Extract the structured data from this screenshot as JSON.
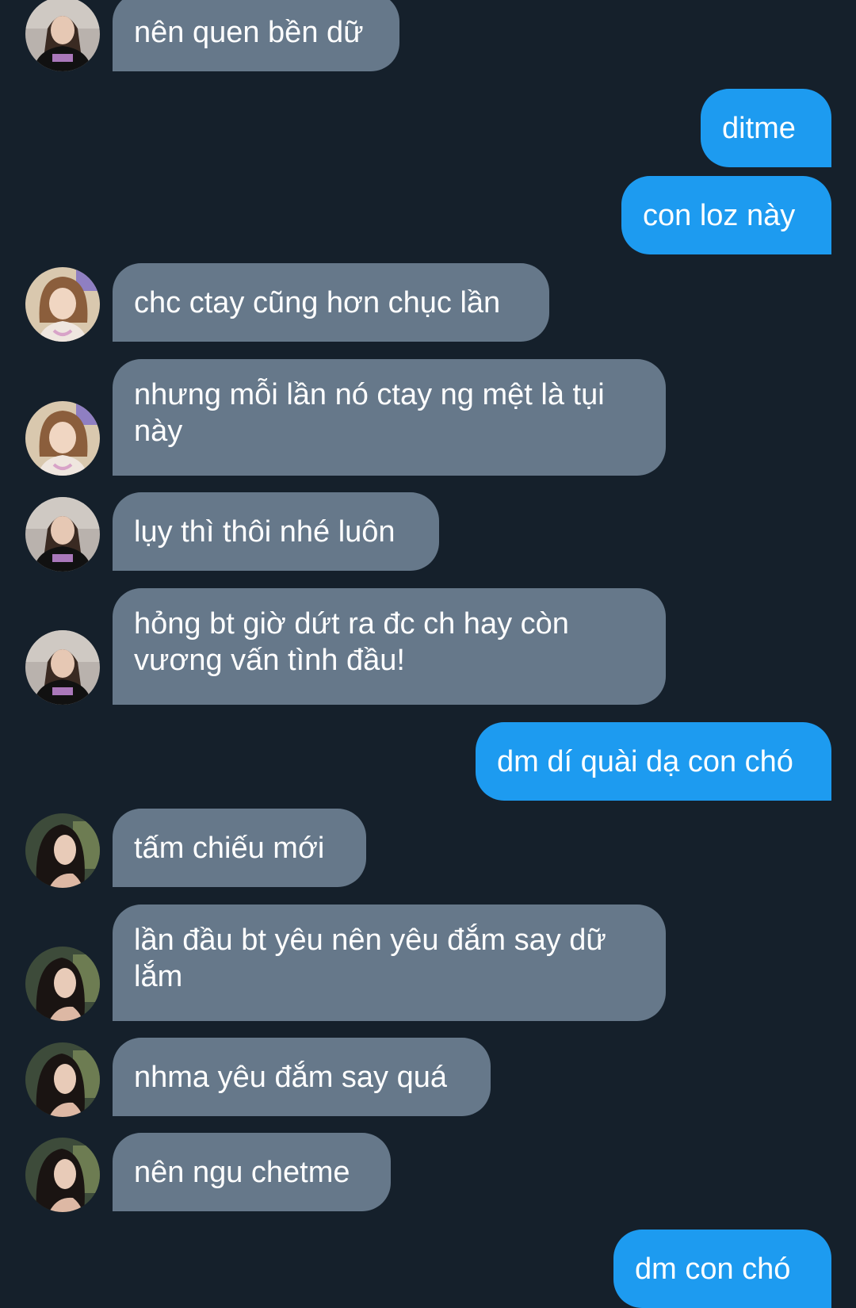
{
  "colors": {
    "background": "#15202b",
    "incoming_bubble": "#66788a",
    "outgoing_bubble": "#1d9bf0",
    "text": "#ffffff"
  },
  "messages": [
    {
      "dir": "in",
      "avatar": "avatar-black-tee-photo",
      "text": "nên quen bền dữ"
    },
    {
      "dir": "out",
      "text": "ditme"
    },
    {
      "dir": "out",
      "text": "con loz này"
    },
    {
      "dir": "in",
      "avatar": "avatar-selfie-photo",
      "text": "chc ctay cũng hơn chục lần"
    },
    {
      "dir": "in",
      "avatar": "avatar-selfie-photo",
      "text": "nhưng mỗi lần nó ctay ng mệt là tụi này"
    },
    {
      "dir": "in",
      "avatar": "avatar-black-tee-photo",
      "text": "lụy thì thôi nhé luôn"
    },
    {
      "dir": "in",
      "avatar": "avatar-black-tee-photo",
      "text": "hỏng bt giờ dứt ra đc ch hay còn vương vấn tình đầu!"
    },
    {
      "dir": "out",
      "text": "dm dí quài dạ con chó"
    },
    {
      "dir": "in",
      "avatar": "avatar-long-hair-photo",
      "text": "tấm chiếu mới"
    },
    {
      "dir": "in",
      "avatar": "avatar-long-hair-photo",
      "text": "lần đầu bt yêu nên yêu đắm say dữ lắm"
    },
    {
      "dir": "in",
      "avatar": "avatar-long-hair-photo",
      "text": "nhma yêu đắm say quá"
    },
    {
      "dir": "in",
      "avatar": "avatar-long-hair-photo",
      "text": "nên ngu chetme"
    },
    {
      "dir": "out",
      "text": "dm con chó"
    }
  ]
}
